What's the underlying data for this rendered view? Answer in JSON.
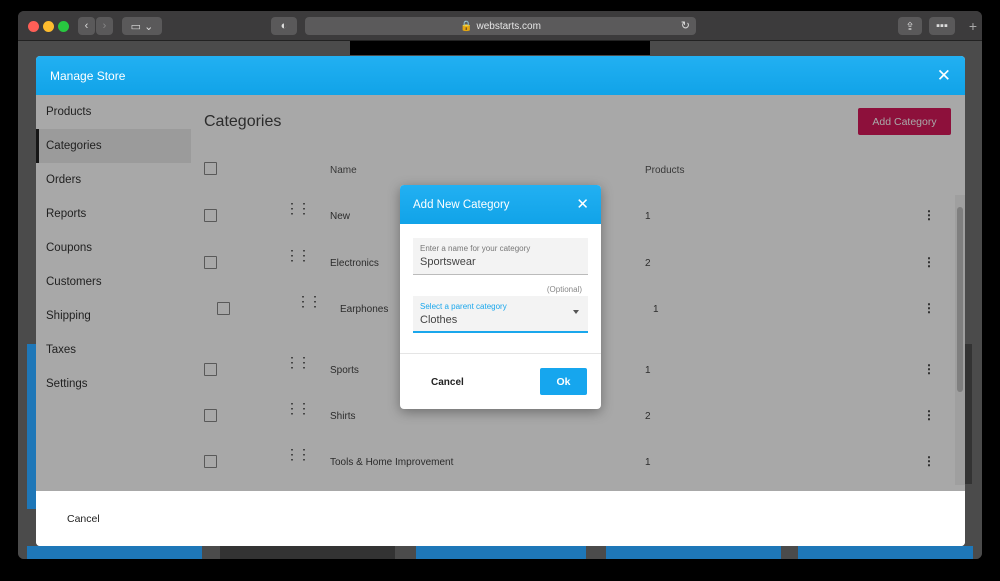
{
  "browser": {
    "url": "webstarts.com"
  },
  "modal": {
    "title": "Manage Store",
    "footer_cancel": "Cancel"
  },
  "sidebar": {
    "items": [
      {
        "label": "Products"
      },
      {
        "label": "Categories"
      },
      {
        "label": "Orders"
      },
      {
        "label": "Reports"
      },
      {
        "label": "Coupons"
      },
      {
        "label": "Customers"
      },
      {
        "label": "Shipping"
      },
      {
        "label": "Taxes"
      },
      {
        "label": "Settings"
      }
    ],
    "active": "Categories"
  },
  "categories": {
    "title": "Categories",
    "add_button": "Add Category",
    "columns": {
      "name": "Name",
      "products": "Products"
    },
    "rows": [
      {
        "name": "New",
        "products": "1"
      },
      {
        "name": "Electronics",
        "products": "2"
      },
      {
        "name": "Earphones",
        "products": "1"
      },
      {
        "name": "Sports",
        "products": "1"
      },
      {
        "name": "Shirts",
        "products": "2"
      },
      {
        "name": "Tools & Home Improvement",
        "products": "1"
      }
    ]
  },
  "dialog": {
    "title": "Add New Category",
    "name_field": {
      "label": "Enter a name for your category",
      "value": "Sportswear"
    },
    "optional": "(Optional)",
    "parent_field": {
      "label": "Select a parent category",
      "value": "Clothes"
    },
    "cancel": "Cancel",
    "ok": "Ok"
  },
  "colors": {
    "header_blue": "#11a3e8",
    "add_category_pink": "#d6195a",
    "ok_blue": "#16a6ee"
  }
}
